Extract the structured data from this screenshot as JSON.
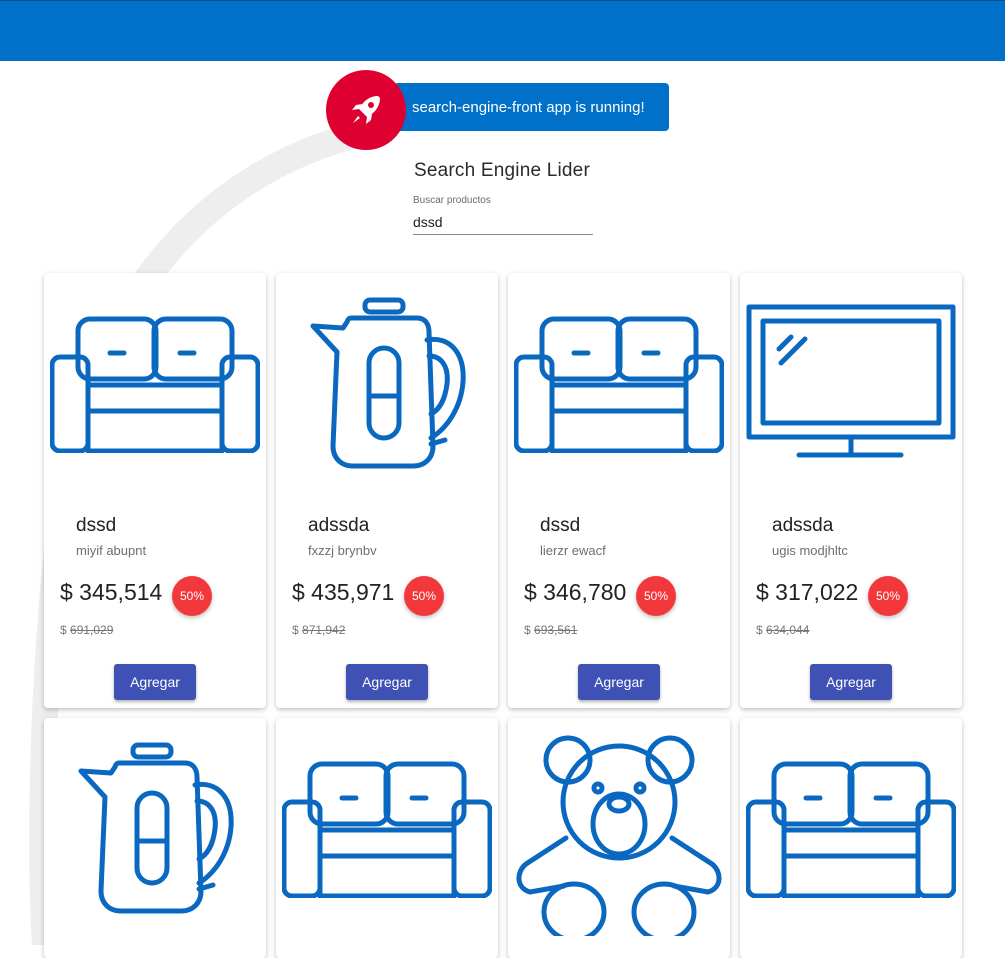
{
  "app": {
    "running_text": "search-engine-front app is running!",
    "title": "Search Engine Lider"
  },
  "search": {
    "label": "Buscar productos",
    "value": "dssd"
  },
  "colors": {
    "topbar": "#0070c9",
    "rocket": "#dd0031",
    "badge": "#f2383a",
    "button": "#3f51b5",
    "icon": "#0a68c1"
  },
  "products": [
    {
      "icon": "sofa-icon",
      "name": "dssd",
      "description": "miyif abupnt",
      "price": "$ 345,514",
      "discount": "50%",
      "currency": "$",
      "old_price": "691,029",
      "button": "Agregar"
    },
    {
      "icon": "kettle-icon",
      "name": "adssda",
      "description": "fxzzj brynbv",
      "price": "$ 435,971",
      "discount": "50%",
      "currency": "$",
      "old_price": "871,942",
      "button": "Agregar"
    },
    {
      "icon": "sofa-icon",
      "name": "dssd",
      "description": "lierzr ewacf",
      "price": "$ 346,780",
      "discount": "50%",
      "currency": "$",
      "old_price": "693,561",
      "button": "Agregar"
    },
    {
      "icon": "tv-icon",
      "name": "adssda",
      "description": "ugis modjhltc",
      "price": "$ 317,022",
      "discount": "50%",
      "currency": "$",
      "old_price": "634,044",
      "button": "Agregar"
    },
    {
      "icon": "kettle-icon"
    },
    {
      "icon": "sofa-icon"
    },
    {
      "icon": "teddy-bear-icon"
    },
    {
      "icon": "sofa-icon"
    }
  ]
}
